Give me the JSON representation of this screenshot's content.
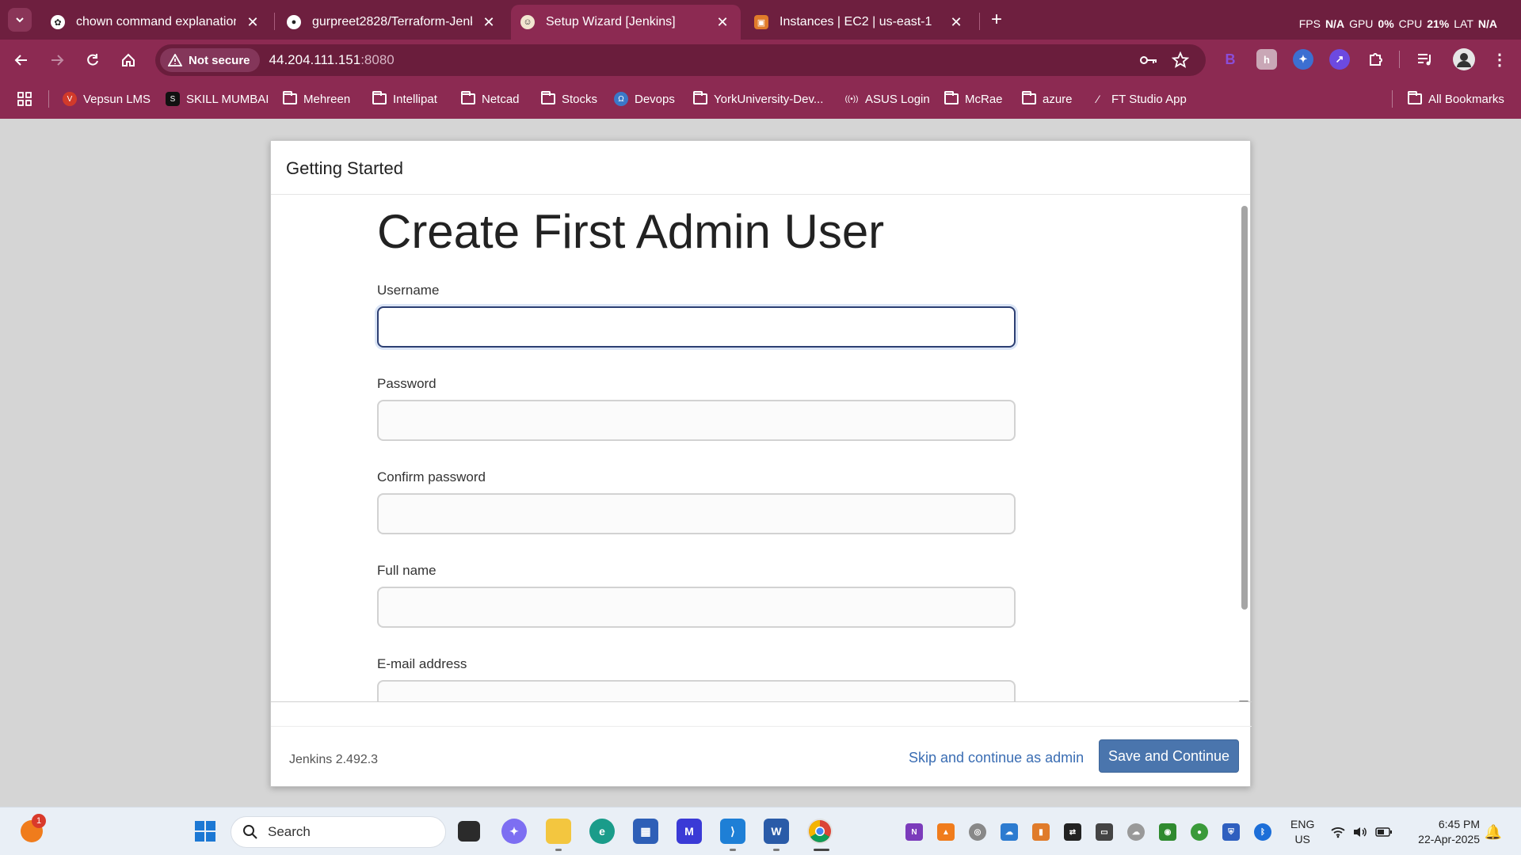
{
  "browser": {
    "tabs": [
      {
        "title": "chown command explanation",
        "icon": "chatgpt-icon"
      },
      {
        "title": "gurpreet2828/Terraform-Jenkins",
        "icon": "github-icon"
      },
      {
        "title": "Setup Wizard [Jenkins]",
        "icon": "jenkins-icon"
      },
      {
        "title": "Instances | EC2 | us-east-1",
        "icon": "aws-icon"
      }
    ],
    "active_tab": 2,
    "perf_overlay": {
      "fps_label": "FPS",
      "fps_value": "N/A",
      "gpu_label": "GPU",
      "gpu_value": "0%",
      "cpu_label": "CPU",
      "cpu_value": "21%",
      "lat_label": "LAT",
      "lat_value": "N/A"
    },
    "security_chip": "Not secure",
    "url_host": "44.204.111.151",
    "url_port": ":8080",
    "bookmarks": [
      "Vepsun LMS",
      "SKILL MUMBAI",
      "Mehreen",
      "Intellipat",
      "Netcad",
      "Stocks",
      "Devops",
      "YorkUniversity-Dev...",
      "ASUS Login",
      "McRae",
      "azure",
      "FT Studio App"
    ],
    "all_bookmarks": "All Bookmarks",
    "colors": {
      "frame": "#6e1f3f",
      "toolbar": "#8c2a52"
    }
  },
  "dialog": {
    "header": "Getting Started",
    "heading": "Create First Admin User",
    "fields": [
      {
        "label": "Username",
        "value": ""
      },
      {
        "label": "Password",
        "value": ""
      },
      {
        "label": "Confirm password",
        "value": ""
      },
      {
        "label": "Full name",
        "value": ""
      },
      {
        "label": "E-mail address",
        "value": ""
      }
    ],
    "version": "Jenkins 2.492.3",
    "skip_link": "Skip and continue as admin",
    "save_button": "Save and Continue",
    "colors": {
      "primary": "#4a75ad",
      "link": "#3a6db3"
    }
  },
  "taskbar": {
    "notification_count": "1",
    "search_placeholder": "Search",
    "lang_line1": "ENG",
    "lang_line2": "US",
    "time": "6:45 PM",
    "date": "22-Apr-2025"
  }
}
